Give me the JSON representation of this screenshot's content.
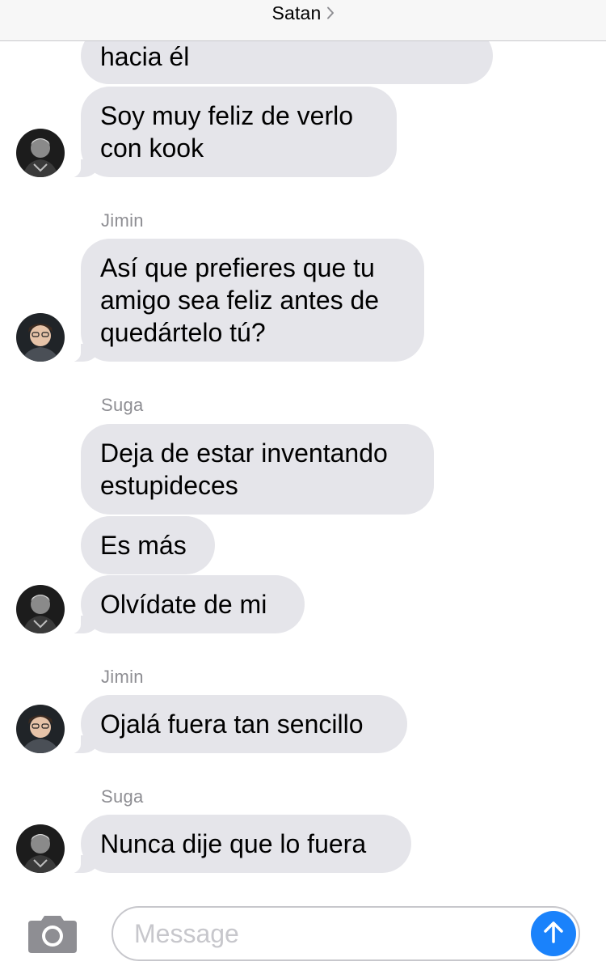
{
  "header": {
    "title": "Satan",
    "chevron_icon": "chevron-right-icon"
  },
  "messages": [
    {
      "text": "hacia él"
    },
    {
      "text": "Soy muy feliz de verlo\ncon kook"
    },
    {
      "sender": "Jimin"
    },
    {
      "text": "Así que prefieres que tu\namigo sea feliz antes de\nquedártelo tú?"
    },
    {
      "sender": "Suga"
    },
    {
      "text": "Deja de estar inventando\nestupideces"
    },
    {
      "text": "Es más"
    },
    {
      "text": "Olvídate de mi"
    },
    {
      "sender": "Jimin"
    },
    {
      "text": "Ojalá fuera tan sencillo"
    },
    {
      "sender": "Suga"
    },
    {
      "text": "Nunca dije que lo fuera"
    }
  ],
  "composer": {
    "placeholder": "Message",
    "camera_icon": "camera-icon",
    "send_icon": "arrow-up-icon"
  },
  "colors": {
    "incoming_bubble": "#e5e5ea",
    "send_button": "#1a82fb",
    "sender_label": "#8e8e93"
  }
}
